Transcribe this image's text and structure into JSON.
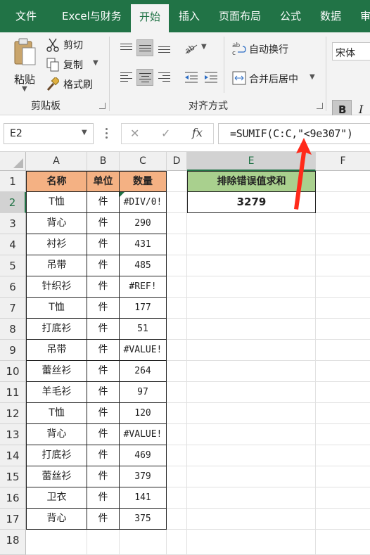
{
  "ribbon_tabs": [
    {
      "label": "文件",
      "active": false
    },
    {
      "label": "Excel与财务",
      "active": false
    },
    {
      "label": "开始",
      "active": true
    },
    {
      "label": "插入",
      "active": false
    },
    {
      "label": "页面布局",
      "active": false
    },
    {
      "label": "公式",
      "active": false
    },
    {
      "label": "数据",
      "active": false
    },
    {
      "label": "审",
      "active": false
    }
  ],
  "clipboard": {
    "paste": "粘贴",
    "cut": "剪切",
    "copy": "复制",
    "format_painter": "格式刷",
    "group_label": "剪贴板"
  },
  "alignment": {
    "wrap_text": "自动换行",
    "merge_center": "合并后居中",
    "group_label": "对齐方式"
  },
  "font": {
    "name": "宋体",
    "bold": "B",
    "italic": "I"
  },
  "formula_bar": {
    "name_box": "E2",
    "cancel": "✕",
    "enter": "✓",
    "fx": "fx",
    "formula": "=SUMIF(C:C,\"<9e307\")"
  },
  "columns": [
    "A",
    "B",
    "C",
    "D",
    "E",
    "F"
  ],
  "rows": [
    "1",
    "2",
    "3",
    "4",
    "5",
    "6",
    "7",
    "8",
    "9",
    "10",
    "11",
    "12",
    "13",
    "14",
    "15",
    "16",
    "17",
    "18"
  ],
  "table": {
    "headers": [
      "名称",
      "单位",
      "数量"
    ],
    "rows": [
      [
        "T恤",
        "件",
        "#DIV/0!"
      ],
      [
        "背心",
        "件",
        "290"
      ],
      [
        "衬衫",
        "件",
        "431"
      ],
      [
        "吊带",
        "件",
        "485"
      ],
      [
        "针织衫",
        "件",
        "#REF!"
      ],
      [
        "T恤",
        "件",
        "177"
      ],
      [
        "打底衫",
        "件",
        "51"
      ],
      [
        "吊带",
        "件",
        "#VALUE!"
      ],
      [
        "蕾丝衫",
        "件",
        "264"
      ],
      [
        "羊毛衫",
        "件",
        "97"
      ],
      [
        "T恤",
        "件",
        "120"
      ],
      [
        "背心",
        "件",
        "#VALUE!"
      ],
      [
        "打底衫",
        "件",
        "469"
      ],
      [
        "蕾丝衫",
        "件",
        "379"
      ],
      [
        "卫衣",
        "件",
        "141"
      ],
      [
        "背心",
        "件",
        "375"
      ]
    ]
  },
  "summary": {
    "label": "排除错误值求和",
    "value": "3279"
  },
  "colors": {
    "accent": "#217346",
    "header_fill": "#f4b183",
    "summary_fill": "#a9d08e",
    "arrow": "#ff2a1a"
  }
}
